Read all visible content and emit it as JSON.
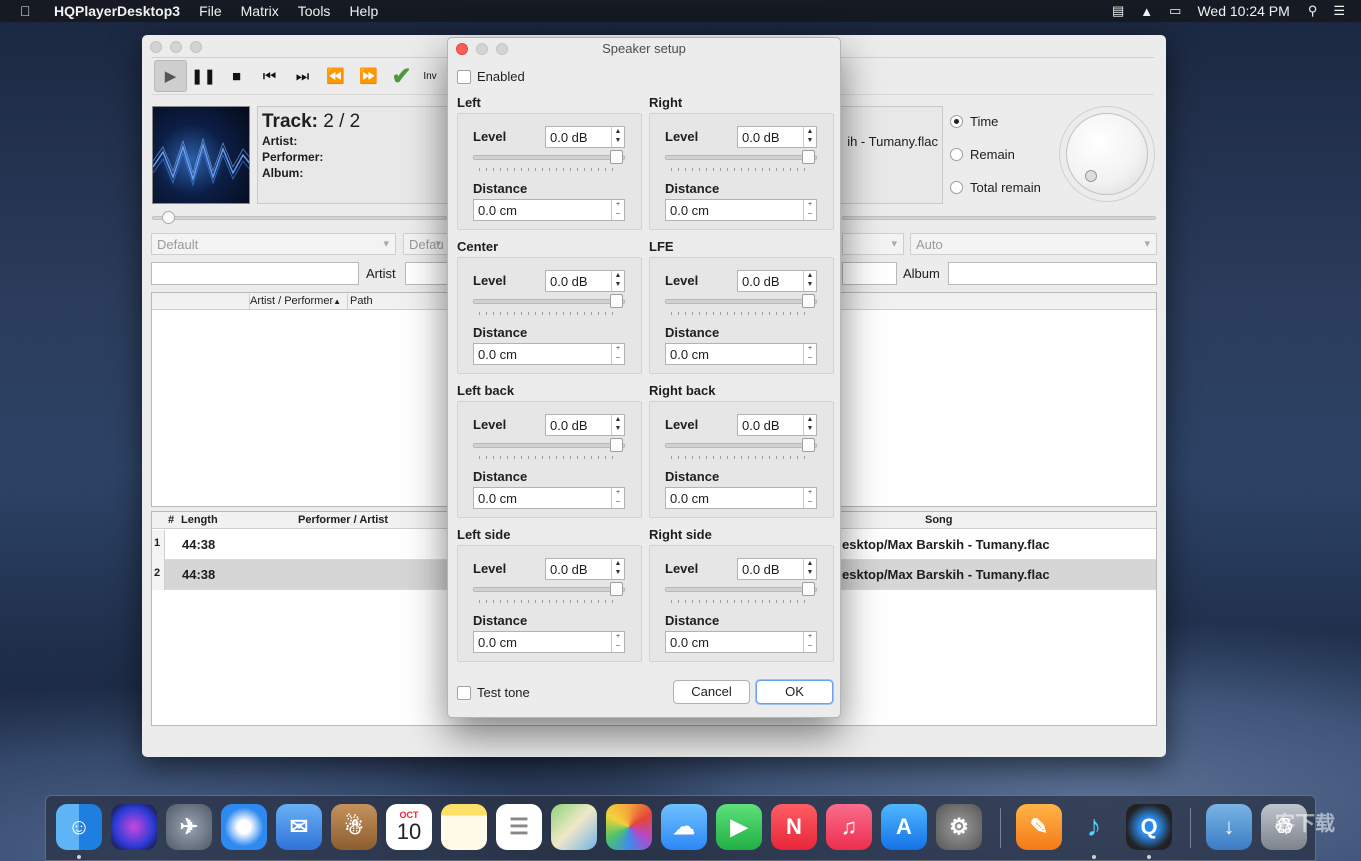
{
  "menubar": {
    "app_name": "HQPlayerDesktop3",
    "items": [
      "File",
      "Matrix",
      "Tools",
      "Help"
    ],
    "clock": "Wed 10:24 PM"
  },
  "toolbar": {
    "inv_label": "Inv"
  },
  "now_playing": {
    "track_label": "Track:",
    "track_value": "2 / 2",
    "artist_label": "Artist:",
    "performer_label": "Performer:",
    "album_label": "Album:",
    "filename_partial": "ih - Tumany.flac"
  },
  "time_mode": {
    "options": [
      "Time",
      "Remain",
      "Total remain"
    ],
    "selected": "Time"
  },
  "combos": {
    "first": "Default",
    "second": "Defau",
    "last": "Auto"
  },
  "search": {
    "artist_label": "Artist",
    "album_label": "Album"
  },
  "library_list": {
    "columns": [
      "Artist / Performer",
      "Path"
    ],
    "sort_indicator": "▲"
  },
  "playlist": {
    "columns": [
      "#",
      "Length",
      "Performer / Artist",
      "Song"
    ],
    "rows": [
      {
        "num": "1",
        "length": "44:38",
        "song": "esktop/Max Barskih - Tumany.flac"
      },
      {
        "num": "2",
        "length": "44:38",
        "song": "esktop/Max Barskih - Tumany.flac"
      }
    ]
  },
  "dialog": {
    "title": "Speaker setup",
    "enabled_label": "Enabled",
    "level_label": "Level",
    "distance_label": "Distance",
    "groups": [
      {
        "name": "Left",
        "level": "0.0 dB",
        "distance": "0.0 cm"
      },
      {
        "name": "Right",
        "level": "0.0 dB",
        "distance": "0.0 cm"
      },
      {
        "name": "Center",
        "level": "0.0 dB",
        "distance": "0.0 cm"
      },
      {
        "name": "LFE",
        "level": "0.0 dB",
        "distance": "0.0 cm"
      },
      {
        "name": "Left back",
        "level": "0.0 dB",
        "distance": "0.0 cm"
      },
      {
        "name": "Right back",
        "level": "0.0 dB",
        "distance": "0.0 cm"
      },
      {
        "name": "Left side",
        "level": "0.0 dB",
        "distance": "0.0 cm"
      },
      {
        "name": "Right side",
        "level": "0.0 dB",
        "distance": "0.0 cm"
      }
    ],
    "level_slider_fraction": 1.0,
    "test_tone_label": "Test tone",
    "cancel_label": "Cancel",
    "ok_label": "OK"
  },
  "dock": {
    "icons": [
      "finder-icon",
      "siri-icon",
      "launchpad-icon",
      "safari-icon",
      "mail-icon",
      "contacts-icon",
      "calendar-icon",
      "notes-icon",
      "reminders-icon",
      "maps-icon",
      "photos-icon",
      "messages-icon",
      "facetime-icon",
      "news-icon",
      "music-icon",
      "app-store-icon",
      "system-preferences-icon",
      "pages-icon",
      "hqplayer-icon",
      "quicktime-icon",
      "downloads-icon",
      "trash-icon"
    ],
    "calendar_month": "OCT",
    "calendar_day": "10"
  },
  "watermark": "客下载"
}
